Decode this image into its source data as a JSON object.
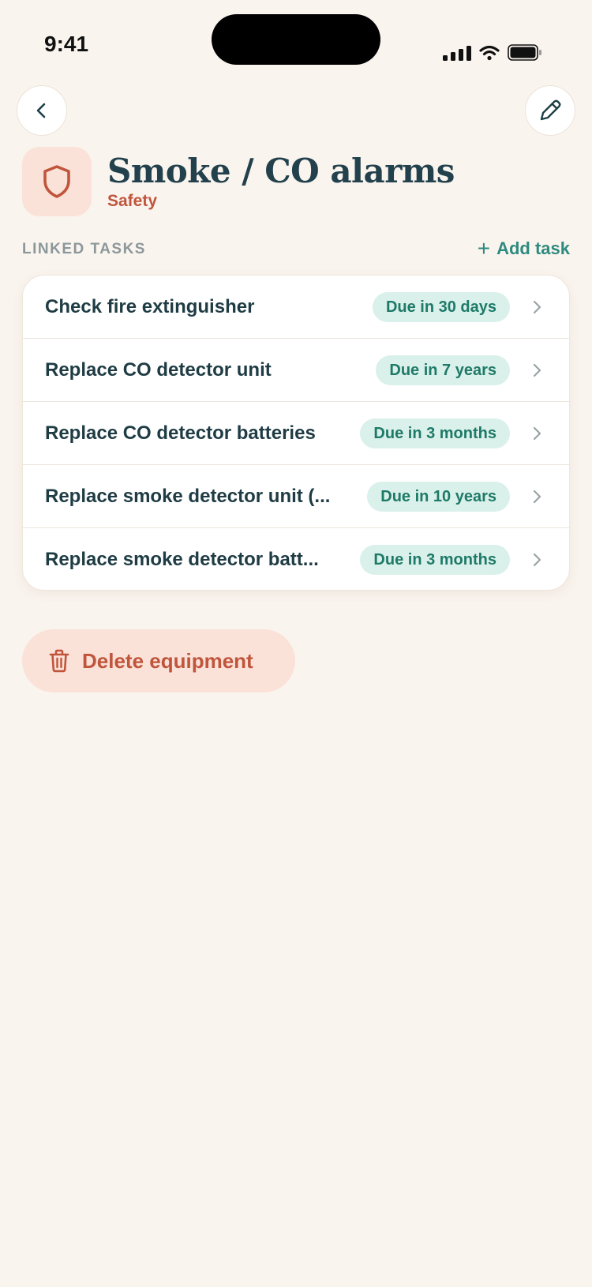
{
  "status_bar": {
    "time": "9:41"
  },
  "header": {
    "back_icon": "chevron-left-icon",
    "edit_icon": "pencil-icon"
  },
  "equipment": {
    "icon": "shield-icon",
    "title": "Smoke / CO alarms",
    "category": "Safety"
  },
  "linked_tasks": {
    "section_label": "LINKED TASKS",
    "add_label": "Add task",
    "add_icon_glyph": "+",
    "items": [
      {
        "name": "Check fire extinguisher",
        "due": "Due in 30 days"
      },
      {
        "name": "Replace CO detector unit",
        "due": "Due in 7 years"
      },
      {
        "name": "Replace CO detector batteries",
        "due": "Due in 3 months"
      },
      {
        "name": "Replace smoke detector unit (...",
        "due": "Due in 10 years"
      },
      {
        "name": "Replace smoke detector batt...",
        "due": "Due in 3 months"
      }
    ]
  },
  "delete": {
    "label": "Delete equipment",
    "icon": "trash-icon"
  },
  "colors": {
    "background": "#faf4ee",
    "accent_orange": "#c0553c",
    "accent_teal": "#2d8a7f",
    "badge_bg": "#daf0ea",
    "tile_bg": "#fbe2d8"
  }
}
